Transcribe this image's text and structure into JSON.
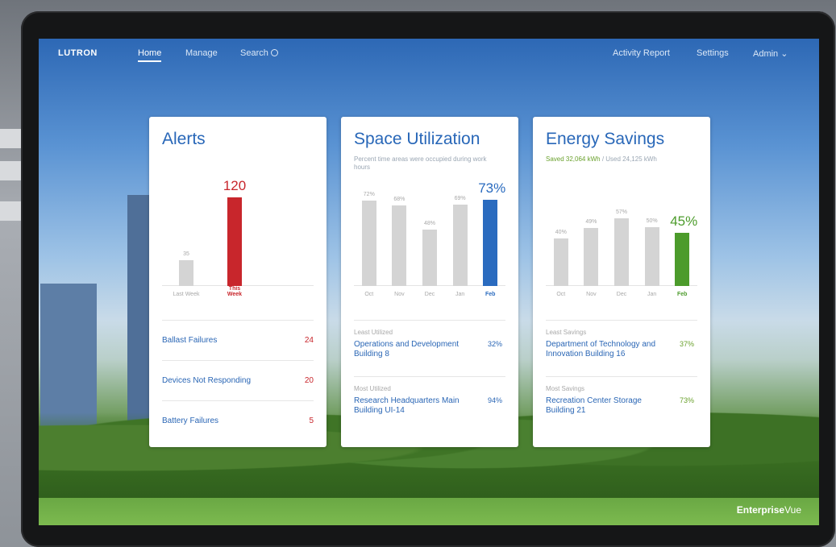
{
  "nav": {
    "logo": "LUTRON",
    "home": "Home",
    "manage": "Manage",
    "search": "Search",
    "activity_report": "Activity Report",
    "settings": "Settings",
    "admin": "Admin ⌄"
  },
  "alerts": {
    "title": "Alerts",
    "chart_data": {
      "type": "bar",
      "categories": [
        "Last Week",
        "This Week"
      ],
      "values": [
        35,
        120
      ],
      "labels": [
        "35",
        "120"
      ]
    },
    "rows": [
      {
        "name": "Ballast Failures",
        "count": "24"
      },
      {
        "name": "Devices Not Responding",
        "count": "20"
      },
      {
        "name": "Battery Failures",
        "count": "5"
      }
    ]
  },
  "space": {
    "title": "Space Utilization",
    "subtitle": "Percent time areas were occupied during work hours",
    "chart_data": {
      "type": "bar",
      "categories": [
        "Oct",
        "Nov",
        "Dec",
        "Jan",
        "Feb"
      ],
      "values": [
        72,
        68,
        48,
        69,
        73
      ],
      "labels": [
        "72%",
        "68%",
        "48%",
        "69%",
        "73%"
      ]
    },
    "least_caption": "Least Utilized",
    "least_name": "Operations and Development Building 8",
    "least_pct": "32%",
    "most_caption": "Most Utilized",
    "most_name": "Research Headquarters Main Building UI-14",
    "most_pct": "94%"
  },
  "energy": {
    "title": "Energy Savings",
    "subtitle_saved": "Saved 32,064 kWh",
    "subtitle_used": " / Used 24,125 kWh",
    "chart_data": {
      "type": "bar",
      "categories": [
        "Oct",
        "Nov",
        "Dec",
        "Jan",
        "Feb"
      ],
      "values": [
        40,
        49,
        57,
        50,
        45
      ],
      "labels": [
        "40%",
        "49%",
        "57%",
        "50%",
        "45%"
      ]
    },
    "least_caption": "Least Savings",
    "least_name": "Department of Technology and Innovation Building 16",
    "least_pct": "37%",
    "most_caption": "Most Savings",
    "most_name": "Recreation Center Storage Building 21",
    "most_pct": "73%"
  },
  "brand": {
    "bold": "Enterprise",
    "light": "Vue"
  },
  "colors": {
    "accent": "#2867b8",
    "alert": "#c8262c",
    "good": "#4c9b2b",
    "neutral_bar": "#d4d4d4"
  }
}
